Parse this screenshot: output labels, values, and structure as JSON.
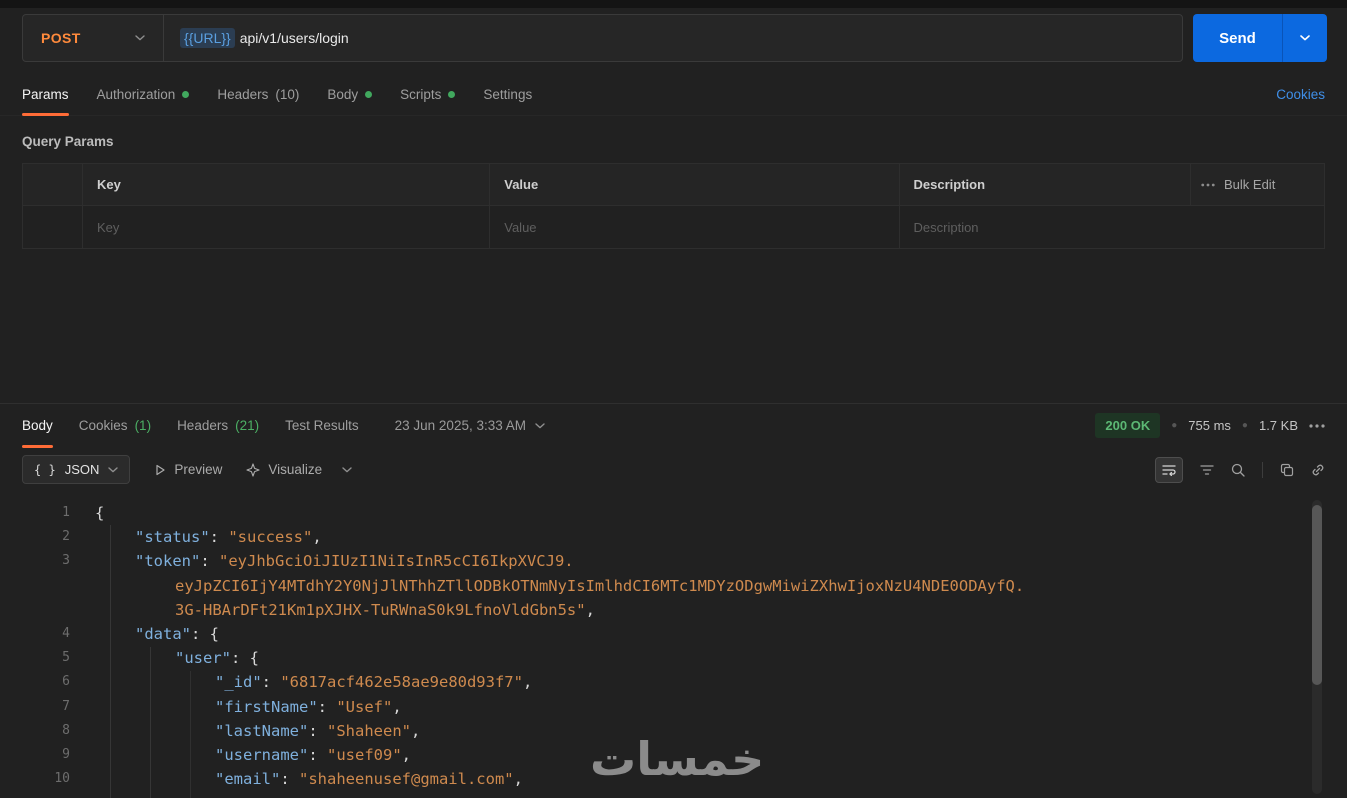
{
  "request_bar": {
    "method": "POST",
    "url_variable": "{{URL}}",
    "url_path": "api/v1/users/login",
    "send_label": "Send"
  },
  "request_tabs": {
    "items": [
      {
        "label": "Params"
      },
      {
        "label": "Authorization"
      },
      {
        "label": "Headers",
        "count": "(10)"
      },
      {
        "label": "Body"
      },
      {
        "label": "Scripts"
      },
      {
        "label": "Settings"
      }
    ],
    "cookies_link": "Cookies"
  },
  "query_params": {
    "title": "Query Params",
    "columns": {
      "key": "Key",
      "value": "Value",
      "description": "Description"
    },
    "bulk_edit_label": "Bulk Edit",
    "placeholders": {
      "key": "Key",
      "value": "Value",
      "description": "Description"
    }
  },
  "response": {
    "tabs": [
      {
        "label": "Body"
      },
      {
        "label": "Cookies",
        "count": "(1)"
      },
      {
        "label": "Headers",
        "count": "(21)"
      },
      {
        "label": "Test Results"
      }
    ],
    "timestamp": "23 Jun 2025, 3:33 AM",
    "status_badge": "200 OK",
    "time": "755 ms",
    "size": "1.7 KB",
    "toolbar": {
      "braces_icon": "{ }",
      "format_label": "JSON",
      "preview_label": "Preview",
      "visualize_label": "Visualize"
    }
  },
  "watermark_text": "خمسات",
  "colors": {
    "accent_orange": "#ff6c37",
    "method_post_orange": "#ff8a3c",
    "send_button_blue": "#0c69e0",
    "link_blue": "#3f8fe8",
    "content_dot_green": "#41a85e",
    "status_ok_green": "#5cb874",
    "json_key_blue": "#7fb0dd",
    "json_string_orange": "#cf8a4e"
  },
  "response_body": {
    "lines": [
      {
        "num": "1",
        "indent": 0,
        "tokens": [
          {
            "c": "punct",
            "t": "{"
          }
        ]
      },
      {
        "num": "2",
        "indent": 1,
        "tokens": [
          {
            "c": "key",
            "t": "\"status\""
          },
          {
            "c": "punct",
            "t": ": "
          },
          {
            "c": "str",
            "t": "\"success\""
          },
          {
            "c": "punct",
            "t": ","
          }
        ]
      },
      {
        "num": "3",
        "indent": 1,
        "tokens": [
          {
            "c": "key",
            "t": "\"token\""
          },
          {
            "c": "punct",
            "t": ": "
          },
          {
            "c": "str",
            "t": "\"eyJhbGciOiJIUzI1NiIsInR5cCI6IkpXVCJ9."
          }
        ]
      },
      {
        "num": "",
        "indent": 2,
        "tokens": [
          {
            "c": "str",
            "t": "eyJpZCI6IjY4MTdhY2Y0NjJlNThhZTllODBkOTNmNyIsImlhdCI6MTc1MDYzODgwMiwiZXhwIjoxNzU4NDE0ODAyfQ."
          }
        ]
      },
      {
        "num": "",
        "indent": 2,
        "tokens": [
          {
            "c": "str",
            "t": "3G-HBArDFt21Km1pXJHX-TuRWnaS0k9LfnoVldGbn5s\""
          },
          {
            "c": "punct",
            "t": ","
          }
        ]
      },
      {
        "num": "4",
        "indent": 1,
        "tokens": [
          {
            "c": "key",
            "t": "\"data\""
          },
          {
            "c": "punct",
            "t": ": {"
          }
        ]
      },
      {
        "num": "5",
        "indent": 2,
        "tokens": [
          {
            "c": "key",
            "t": "\"user\""
          },
          {
            "c": "punct",
            "t": ": {"
          }
        ]
      },
      {
        "num": "6",
        "indent": 3,
        "tokens": [
          {
            "c": "key",
            "t": "\"_id\""
          },
          {
            "c": "punct",
            "t": ": "
          },
          {
            "c": "str",
            "t": "\"6817acf462e58ae9e80d93f7\""
          },
          {
            "c": "punct",
            "t": ","
          }
        ]
      },
      {
        "num": "7",
        "indent": 3,
        "tokens": [
          {
            "c": "key",
            "t": "\"firstName\""
          },
          {
            "c": "punct",
            "t": ": "
          },
          {
            "c": "str",
            "t": "\"Usef\""
          },
          {
            "c": "punct",
            "t": ","
          }
        ]
      },
      {
        "num": "8",
        "indent": 3,
        "tokens": [
          {
            "c": "key",
            "t": "\"lastName\""
          },
          {
            "c": "punct",
            "t": ": "
          },
          {
            "c": "str",
            "t": "\"Shaheen\""
          },
          {
            "c": "punct",
            "t": ","
          }
        ]
      },
      {
        "num": "9",
        "indent": 3,
        "tokens": [
          {
            "c": "key",
            "t": "\"username\""
          },
          {
            "c": "punct",
            "t": ": "
          },
          {
            "c": "str",
            "t": "\"usef09\""
          },
          {
            "c": "punct",
            "t": ","
          }
        ]
      },
      {
        "num": "10",
        "indent": 3,
        "tokens": [
          {
            "c": "key",
            "t": "\"email\""
          },
          {
            "c": "punct",
            "t": ": "
          },
          {
            "c": "str",
            "t": "\"shaheenusef@gmail.com\""
          },
          {
            "c": "punct",
            "t": ","
          }
        ]
      }
    ]
  }
}
